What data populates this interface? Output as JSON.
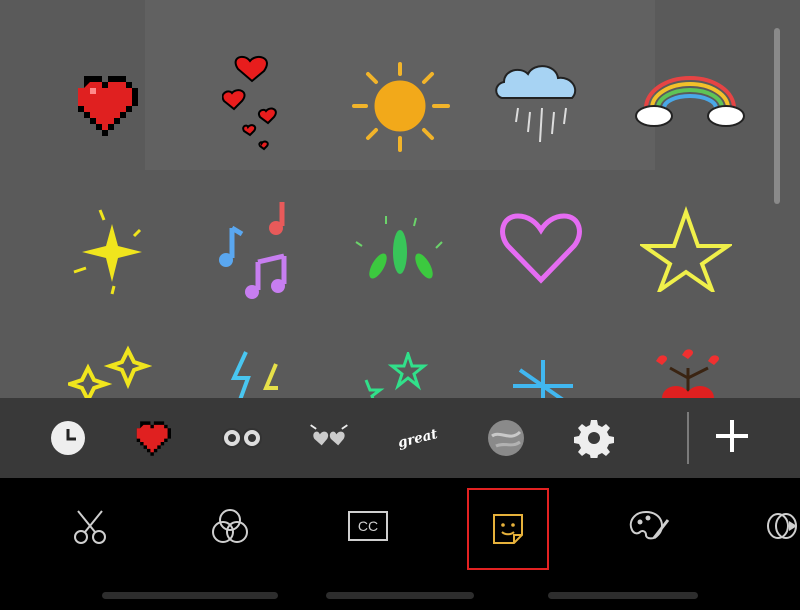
{
  "tools": [
    {
      "name": "scissors-icon"
    },
    {
      "name": "filters-icon"
    },
    {
      "name": "captions-icon",
      "label": "CC"
    },
    {
      "name": "sticker-icon",
      "selected": true
    },
    {
      "name": "palette-icon"
    },
    {
      "name": "overlay-icon"
    }
  ],
  "tray": [
    {
      "name": "recent-icon"
    },
    {
      "name": "pixel-heart-icon"
    },
    {
      "name": "eyes-icon"
    },
    {
      "name": "sparkle-heart-icon"
    },
    {
      "name": "great-text-icon",
      "label": "great!"
    },
    {
      "name": "marble-icon"
    },
    {
      "name": "gear-icon"
    },
    {
      "name": "plus-icon"
    }
  ]
}
